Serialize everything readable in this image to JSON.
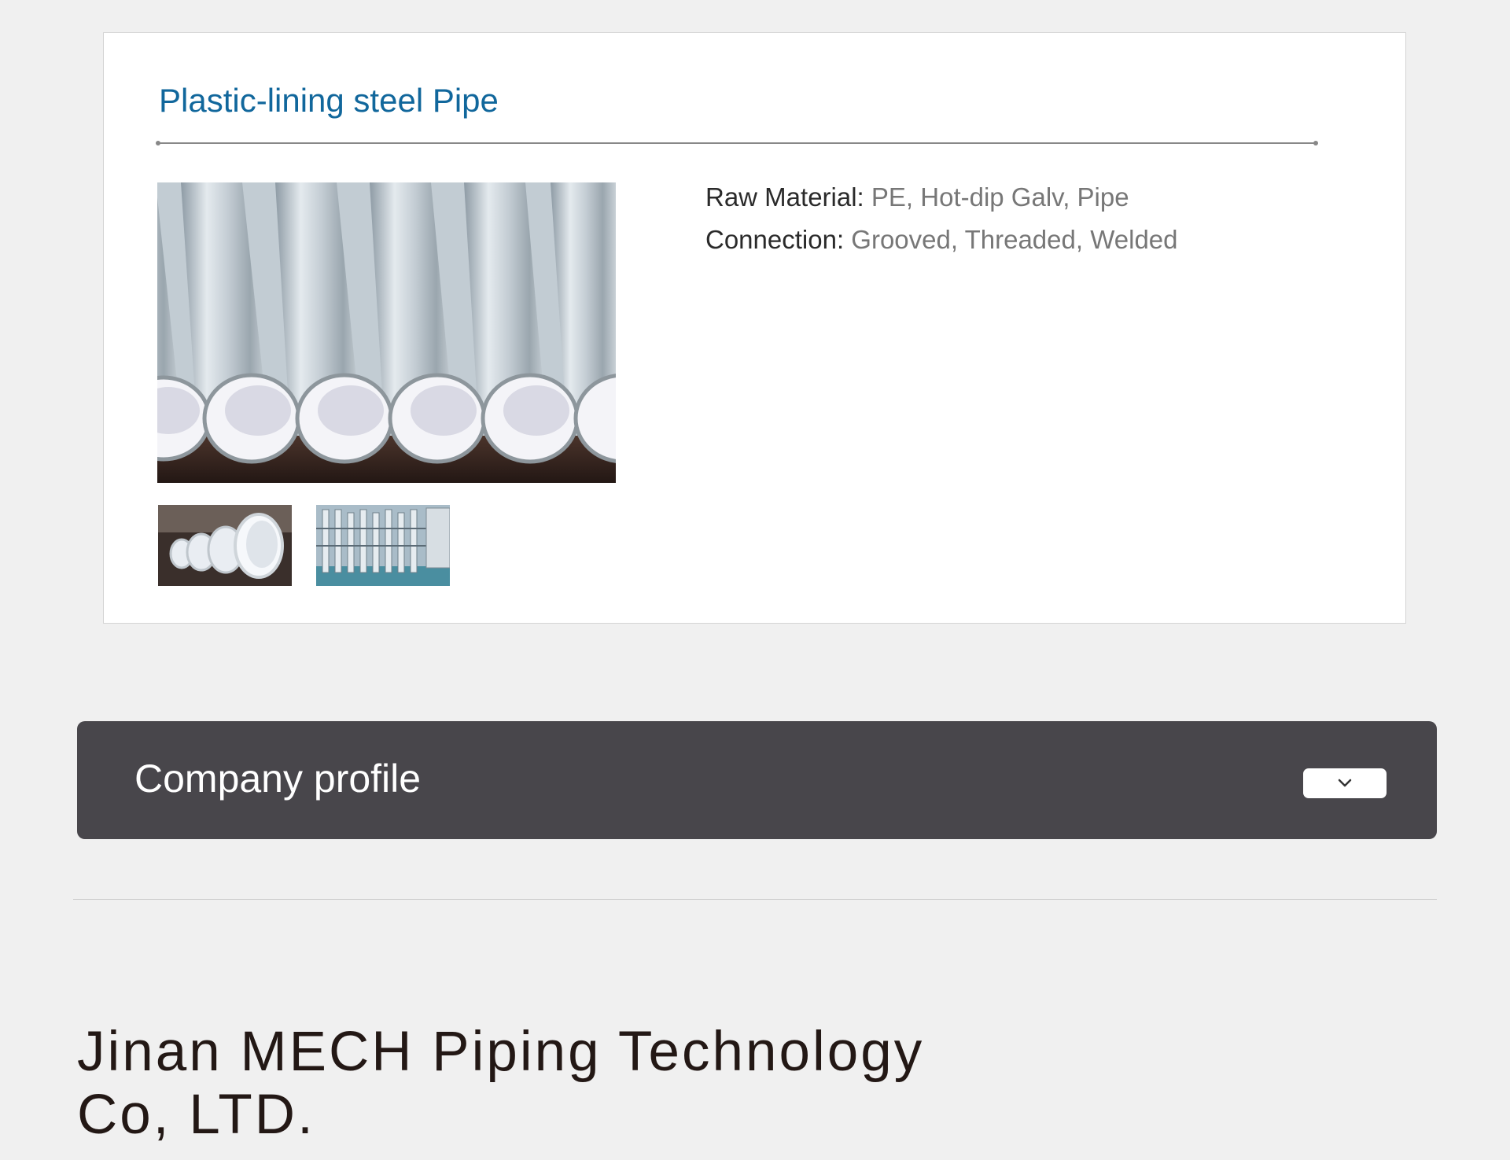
{
  "product": {
    "title": "Plastic-lining steel Pipe",
    "main_image_alt": "Plastic-lining steel pipes",
    "thumbnails": [
      {
        "alt": "Plastic-lined pipe cross sections"
      },
      {
        "alt": "Pipe installation"
      }
    ],
    "specs": [
      {
        "label": "Raw Material:",
        "value": " PE, Hot-dip Galv, Pipe"
      },
      {
        "label": "Connection:",
        "value": " Grooved, Threaded, Welded"
      }
    ]
  },
  "company_profile": {
    "label": "Company profile",
    "toggle_icon": "chevron-down-icon"
  },
  "company": {
    "name_line1": "Jinan MECH Piping Technology",
    "name_line2": "Co, LTD."
  },
  "colors": {
    "accent": "#11679c",
    "profile_bar": "#48464b",
    "background": "#f0f0f0"
  }
}
